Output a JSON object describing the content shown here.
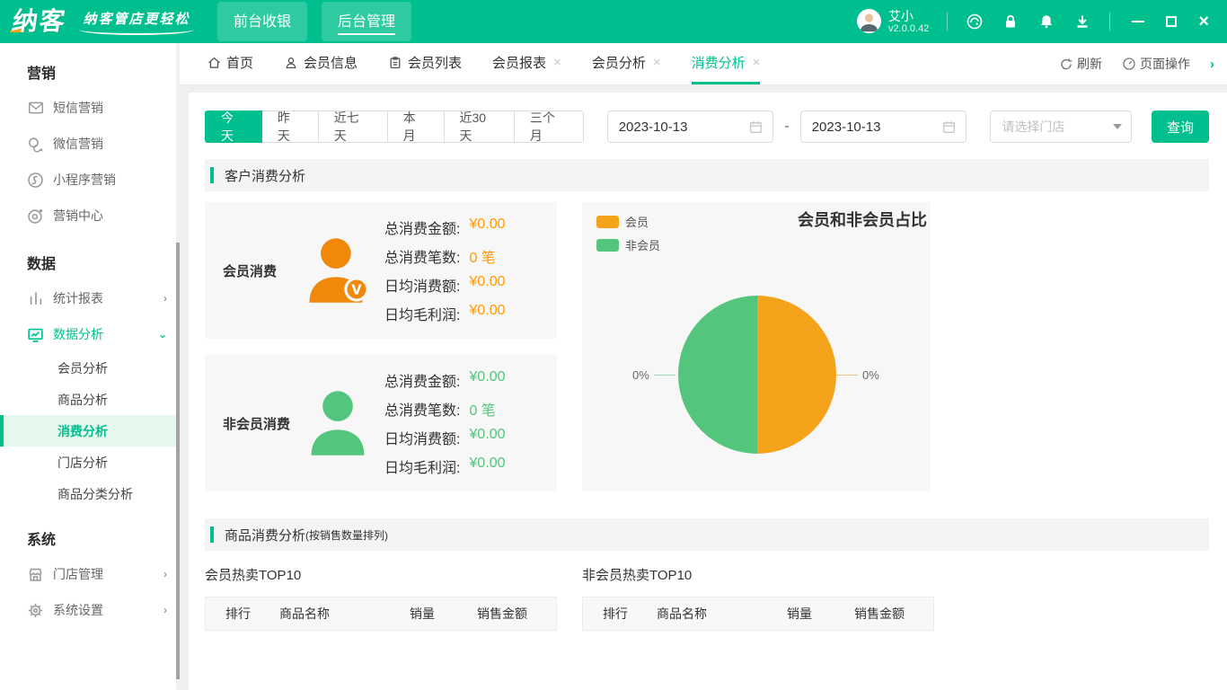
{
  "colors": {
    "brand_green": "#00bf8e",
    "pie_orange": "#f5a31b",
    "pie_green": "#53c57d",
    "value_orange": "#ff9900",
    "value_green": "#53c57d"
  },
  "header": {
    "logo": "纳客",
    "slogan": "纳客管店更轻松",
    "nav_front": "前台收银",
    "nav_back": "后台管理",
    "user_name": "艾小",
    "version": "v2.0.0.42"
  },
  "sidebar": {
    "section_marketing": "营销",
    "item_sms": "短信营销",
    "item_wechat": "微信营销",
    "item_miniapp": "小程序营销",
    "item_marketing_center": "营销中心",
    "section_data": "数据",
    "item_stat_report": "统计报表",
    "item_data_analysis": "数据分析",
    "sub_member": "会员分析",
    "sub_product": "商品分析",
    "sub_consumption": "消费分析",
    "sub_store": "门店分析",
    "sub_category": "商品分类分析",
    "section_system": "系统",
    "item_store_mgmt": "门店管理",
    "item_settings": "系统设置"
  },
  "tabbar": {
    "home": "首页",
    "member_info": "会员信息",
    "member_list": "会员列表",
    "member_report": "会员报表",
    "member_analysis": "会员分析",
    "consumption_analysis": "消费分析",
    "close_glyph": "×",
    "refresh": "刷新",
    "page_actions": "页面操作",
    "more_glyph": "›"
  },
  "filters": {
    "today": "今天",
    "yesterday": "昨天",
    "last7": "近七天",
    "this_month": "本月",
    "last30": "近30天",
    "three_months": "三个月",
    "date_start": "2023-10-13",
    "range_sep": "-",
    "date_end": "2023-10-13",
    "store_placeholder": "请选择门店",
    "query": "查询"
  },
  "sections": {
    "customer_title": "客户消费分析",
    "product_title": "商品消费分析",
    "product_note": "(按销售数量排列)"
  },
  "member_card": {
    "title": "会员消费",
    "rows": [
      {
        "label": "总消费金额:",
        "value": "¥0.00"
      },
      {
        "label": "总消费笔数:",
        "value": "0 笔"
      },
      {
        "label": "日均消费额:",
        "value": "¥0.00"
      },
      {
        "label": "日均毛利润:",
        "value": "¥0.00"
      }
    ]
  },
  "nonmember_card": {
    "title": "非会员消费",
    "rows": [
      {
        "label": "总消费金额:",
        "value": "¥0.00"
      },
      {
        "label": "总消费笔数:",
        "value": "0 笔"
      },
      {
        "label": "日均消费额:",
        "value": "¥0.00"
      },
      {
        "label": "日均毛利润:",
        "value": "¥0.00"
      }
    ]
  },
  "chart_data": {
    "type": "pie",
    "title": "会员和非会员占比",
    "legend": [
      "会员",
      "非会员"
    ],
    "legend_position": "top-left",
    "slices": [
      {
        "label": "会员",
        "percent_label": "0%",
        "display_fraction": 0.5,
        "color": "#f5a31b",
        "side": "right"
      },
      {
        "label": "非会员",
        "percent_label": "0%",
        "display_fraction": 0.5,
        "color": "#53c57d",
        "side": "left"
      }
    ]
  },
  "top_tables": {
    "member_title": "会员热卖TOP10",
    "nonmember_title": "非会员热卖TOP10",
    "headers": [
      "排行",
      "商品名称",
      "销量",
      "销售金额"
    ],
    "rows": []
  }
}
